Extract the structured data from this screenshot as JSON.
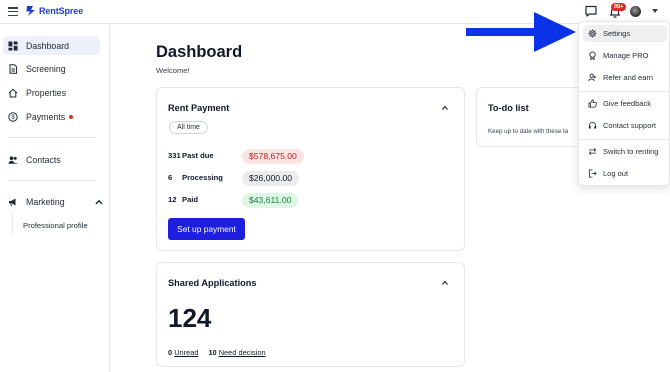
{
  "app": {
    "name": "RentSpree",
    "colors": {
      "brand": "#1f3ccf",
      "primary_button": "#1e1ee0",
      "arrow": "#0a32e6"
    }
  },
  "header": {
    "notification_badge": "99+"
  },
  "sidebar": {
    "items": [
      {
        "label": "Dashboard",
        "icon": "grid-icon",
        "active": true
      },
      {
        "label": "Screening",
        "icon": "document-icon"
      },
      {
        "label": "Properties",
        "icon": "home-icon"
      },
      {
        "label": "Payments",
        "icon": "dollar-icon",
        "has_dot": true
      },
      {
        "label": "Contacts",
        "icon": "people-icon"
      },
      {
        "label": "Marketing",
        "icon": "megaphone-icon",
        "expanded": true
      }
    ],
    "sub_items": [
      {
        "label": "Professional profile"
      }
    ]
  },
  "main": {
    "title": "Dashboard",
    "welcome": "Welcome!",
    "rent_payment": {
      "title": "Rent Payment",
      "filter": "All time",
      "rows": [
        {
          "count": "331",
          "label": "Past due",
          "amount": "$578,675.00",
          "status": "red"
        },
        {
          "count": "6",
          "label": "Processing",
          "amount": "$26,000.00",
          "status": "gray"
        },
        {
          "count": "12",
          "label": "Paid",
          "amount": "$43,611.00",
          "status": "green"
        }
      ],
      "button": "Set up payment"
    },
    "shared_applications": {
      "title": "Shared Applications",
      "total": "124",
      "unread_count": "0",
      "unread_label": "Unread",
      "need_decision_count": "10",
      "need_decision_label": "Need decision"
    },
    "todo": {
      "title": "To-do list",
      "description": "Keep up to date with these ta"
    }
  },
  "user_menu": {
    "items": [
      {
        "label": "Settings",
        "icon": "gear-icon",
        "highlighted": true
      },
      {
        "label": "Manage PRO",
        "icon": "badge-icon"
      },
      {
        "label": "Refer and earn",
        "icon": "refer-icon"
      },
      {
        "label": "Give feedback",
        "icon": "thumbs-up-icon"
      },
      {
        "label": "Contact support",
        "icon": "headset-icon"
      },
      {
        "label": "Switch to renting",
        "icon": "switch-arrows-icon"
      },
      {
        "label": "Log out",
        "icon": "logout-icon"
      }
    ]
  }
}
